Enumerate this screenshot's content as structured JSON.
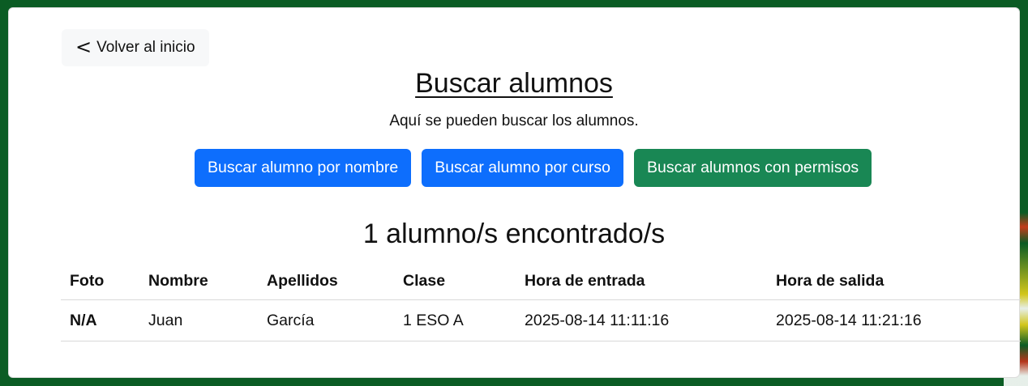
{
  "nav": {
    "back_label": "Volver al inicio",
    "back_icon": "chevron-left-icon"
  },
  "header": {
    "title": "Buscar alumnos",
    "subtitle": "Aquí se pueden buscar los alumnos."
  },
  "actions": {
    "by_name": "Buscar alumno por nombre",
    "by_course": "Buscar alumno por curso",
    "with_permissions": "Buscar alumnos con permisos"
  },
  "colors": {
    "primary": "#0d6efd",
    "success": "#198754",
    "background": "#0b5c24"
  },
  "results": {
    "count_text": "1 alumno/s encontrado/s",
    "columns": [
      "Foto",
      "Nombre",
      "Apellidos",
      "Clase",
      "Hora de entrada",
      "Hora de salida"
    ],
    "rows": [
      [
        "N/A",
        "Juan",
        "García",
        "1 ESO A",
        "2025-08-14 11:11:16",
        "2025-08-14 11:21:16"
      ]
    ]
  }
}
